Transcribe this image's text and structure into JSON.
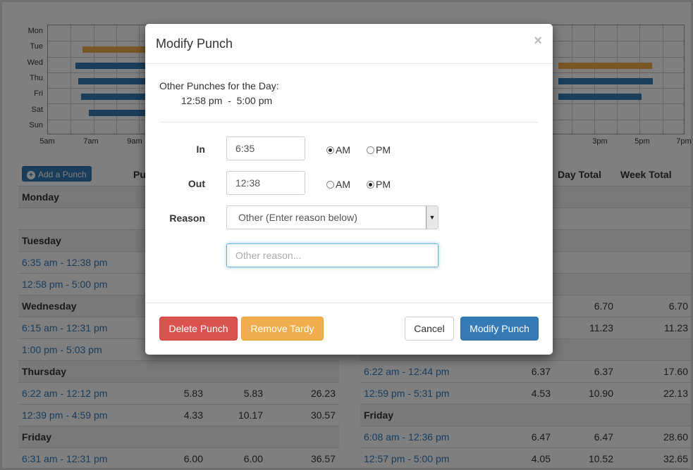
{
  "chart": {
    "days": [
      "Mon",
      "Tue",
      "Wed",
      "Thu",
      "Fri",
      "Sat",
      "Sun"
    ],
    "time_labels": [
      "5am",
      "7am",
      "9am",
      "3pm",
      "5pm",
      "7pm"
    ],
    "colors": {
      "regular": "#337ab7",
      "tardy": "#f0ad4e"
    }
  },
  "left_table": {
    "add_button_label": "Add a Punch",
    "header_partial": "Pu",
    "rows": [
      {
        "type": "day",
        "label": "Monday",
        "v1": "",
        "v2": "",
        "v3": ""
      },
      {
        "type": "blank",
        "label": "",
        "v1": "",
        "v2": "",
        "v3": ""
      },
      {
        "type": "day",
        "label": "Tuesday",
        "v1": "",
        "v2": "",
        "v3": ""
      },
      {
        "type": "punch",
        "label": "6:35 am - 12:38 pm",
        "v1": "",
        "v2": "",
        "v3": ""
      },
      {
        "type": "punch",
        "label": "12:58 pm - 5:00 pm",
        "v1": "",
        "v2": "",
        "v3": ""
      },
      {
        "type": "day",
        "label": "Wednesday",
        "v1": "",
        "v2": "",
        "v3": ""
      },
      {
        "type": "punch",
        "label": "6:15 am - 12:31 pm",
        "v1": "",
        "v2": "",
        "v3": ""
      },
      {
        "type": "punch",
        "label": "1:00 pm - 5:03 pm",
        "v1": "",
        "v2": "",
        "v3": ""
      },
      {
        "type": "day",
        "label": "Thursday",
        "v1": "",
        "v2": "",
        "v3": ""
      },
      {
        "type": "punch",
        "label": "6:22 am - 12:12 pm",
        "v1": "5.83",
        "v2": "5.83",
        "v3": "26.23"
      },
      {
        "type": "punch",
        "label": "12:39 pm - 4:59 pm",
        "v1": "4.33",
        "v2": "10.17",
        "v3": "30.57"
      },
      {
        "type": "day",
        "label": "Friday",
        "v1": "",
        "v2": "",
        "v3": ""
      },
      {
        "type": "punch",
        "label": "6:31 am - 12:31 pm",
        "v1": "6.00",
        "v2": "6.00",
        "v3": "36.57"
      }
    ]
  },
  "right_table": {
    "headers": {
      "day_total": "Day Total",
      "week_total": "Week Total"
    },
    "rows": [
      {
        "type": "day",
        "label": "",
        "v1": "",
        "v2": "",
        "v3": ""
      },
      {
        "type": "blank",
        "label": "",
        "v1": "",
        "v2": "",
        "v3": ""
      },
      {
        "type": "day",
        "label": "",
        "v1": "",
        "v2": "",
        "v3": ""
      },
      {
        "type": "blank",
        "label": "",
        "v1": "",
        "v2": "",
        "v3": ""
      },
      {
        "type": "day",
        "label": "",
        "v1": "",
        "v2": "",
        "v3": ""
      },
      {
        "type": "punch",
        "label": "",
        "v1": "",
        "v2": "6.70",
        "v3": "6.70"
      },
      {
        "type": "punch",
        "label": "",
        "v1": "",
        "v2": "11.23",
        "v3": "11.23"
      },
      {
        "type": "day",
        "label": "",
        "v1": "",
        "v2": "",
        "v3": ""
      },
      {
        "type": "punch",
        "label": "6:22 am - 12:44 pm",
        "v1": "6.37",
        "v2": "6.37",
        "v3": "17.60"
      },
      {
        "type": "punch",
        "label": "12:59 pm - 5:31 pm",
        "v1": "4.53",
        "v2": "10.90",
        "v3": "22.13"
      },
      {
        "type": "day",
        "label": "Friday",
        "v1": "",
        "v2": "",
        "v3": ""
      },
      {
        "type": "punch",
        "label": "6:08 am - 12:36 pm",
        "v1": "6.47",
        "v2": "6.47",
        "v3": "28.60"
      },
      {
        "type": "punch",
        "label": "12:57 pm - 5:00 pm",
        "v1": "4.05",
        "v2": "10.52",
        "v3": "32.65"
      }
    ]
  },
  "modal": {
    "title": "Modify Punch",
    "close_glyph": "×",
    "other_punches_label": "Other Punches for the Day:",
    "other_punches_value": "12:58 pm  -  5:00 pm",
    "in_label": "In",
    "in_value": "6:35",
    "in_selected": "AM",
    "out_label": "Out",
    "out_value": "12:38",
    "out_selected": "PM",
    "am_label": "AM",
    "pm_label": "PM",
    "reason_label": "Reason",
    "reason_selected": "Other (Enter reason below)",
    "other_reason_placeholder": "Other reason...",
    "buttons": {
      "delete": "Delete Punch",
      "remove_tardy": "Remove Tardy",
      "cancel": "Cancel",
      "modify": "Modify Punch"
    }
  }
}
